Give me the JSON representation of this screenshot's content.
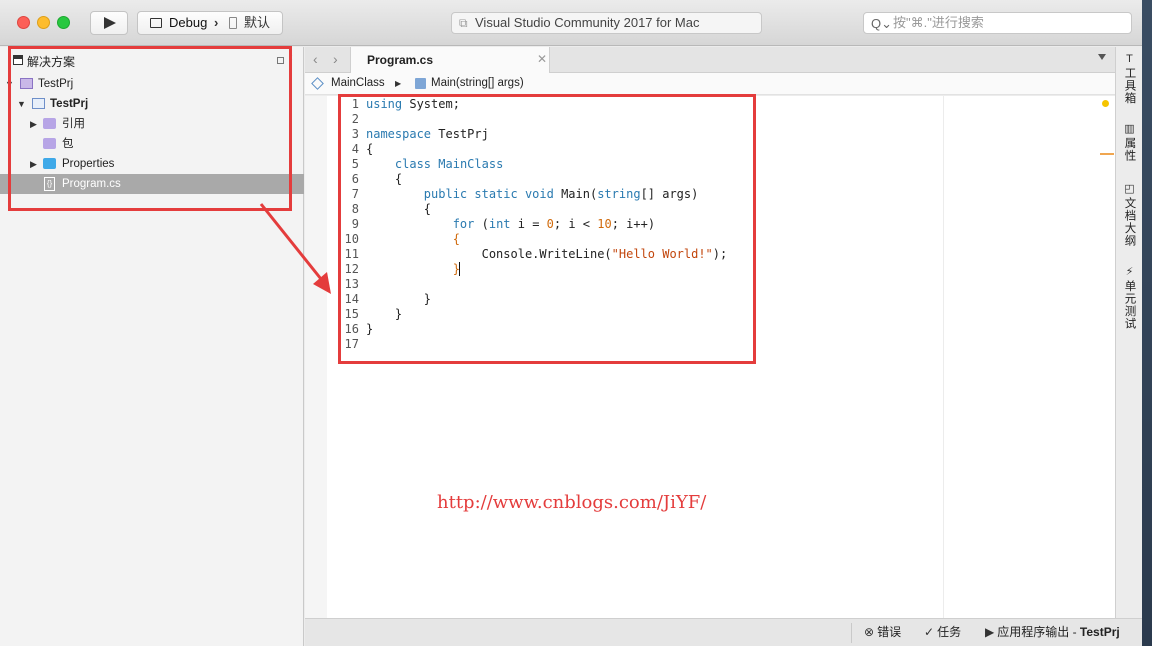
{
  "toolbar": {
    "config_label": "Debug",
    "config_chevron": "›",
    "device_label": "默认",
    "status_icon": "⧉",
    "status_title": "Visual Studio Community 2017 for Mac",
    "search_icon": "Q⌄",
    "search_placeholder": "按\"⌘.\"进行搜索"
  },
  "solution_pad": {
    "title": "解决方案",
    "close_glyph": "‹",
    "tree": [
      {
        "label": "TestPrj",
        "bold": false
      },
      {
        "label": "TestPrj",
        "bold": true
      },
      {
        "label": "引用",
        "bold": false
      },
      {
        "label": "包",
        "bold": false
      },
      {
        "label": "Properties",
        "bold": false
      },
      {
        "label": "Program.cs",
        "bold": false,
        "file_icon": "{}"
      }
    ]
  },
  "editor": {
    "nav_back": "‹",
    "nav_forward": "›",
    "tab_label": "Program.cs",
    "tab_close": "✕",
    "breadcrumb": {
      "class": "MainClass",
      "separator": "▶",
      "method": "Main(string[] args)"
    },
    "lines": [
      {
        "n": "1",
        "tokens": [
          {
            "t": "using",
            "k": "kw"
          },
          {
            "t": " System;"
          }
        ]
      },
      {
        "n": "2",
        "tokens": []
      },
      {
        "n": "3",
        "tokens": [
          {
            "t": "namespace",
            "k": "kw"
          },
          {
            "t": " TestPrj"
          }
        ]
      },
      {
        "n": "4",
        "tokens": [
          {
            "t": "{"
          }
        ]
      },
      {
        "n": "5",
        "tokens": [
          {
            "t": "    "
          },
          {
            "t": "class",
            "k": "kw"
          },
          {
            "t": " "
          },
          {
            "t": "MainClass",
            "k": "ty"
          }
        ]
      },
      {
        "n": "6",
        "tokens": [
          {
            "t": "    {"
          }
        ]
      },
      {
        "n": "7",
        "tokens": [
          {
            "t": "        "
          },
          {
            "t": "public static void",
            "k": "kw"
          },
          {
            "t": " Main("
          },
          {
            "t": "string",
            "k": "kw"
          },
          {
            "t": "[] args)"
          }
        ]
      },
      {
        "n": "8",
        "tokens": [
          {
            "t": "        {"
          }
        ]
      },
      {
        "n": "9",
        "tokens": [
          {
            "t": "            "
          },
          {
            "t": "for",
            "k": "kw"
          },
          {
            "t": " ("
          },
          {
            "t": "int",
            "k": "kw"
          },
          {
            "t": " i = "
          },
          {
            "t": "0",
            "k": "nm"
          },
          {
            "t": "; i < "
          },
          {
            "t": "10",
            "k": "nm"
          },
          {
            "t": "; i++)"
          }
        ]
      },
      {
        "n": "10",
        "tokens": [
          {
            "t": "            "
          },
          {
            "t": "{",
            "k": "nm"
          }
        ]
      },
      {
        "n": "11",
        "tokens": [
          {
            "t": "                Console.WriteLine("
          },
          {
            "t": "\"Hello World!\"",
            "k": "st"
          },
          {
            "t": ");"
          }
        ]
      },
      {
        "n": "12",
        "tokens": [
          {
            "t": "            "
          },
          {
            "t": "}",
            "k": "nm"
          },
          {
            "t": "",
            "k": "caret"
          }
        ]
      },
      {
        "n": "13",
        "tokens": []
      },
      {
        "n": "14",
        "tokens": [
          {
            "t": "        }"
          }
        ]
      },
      {
        "n": "15",
        "tokens": [
          {
            "t": "    }"
          }
        ]
      },
      {
        "n": "16",
        "tokens": [
          {
            "t": "}"
          }
        ]
      },
      {
        "n": "17",
        "tokens": []
      }
    ]
  },
  "right_bar": [
    {
      "icon": "T",
      "label": "工具箱"
    },
    {
      "icon": "▥",
      "label": "属性"
    },
    {
      "icon": "◰",
      "label": "文档大纲"
    },
    {
      "icon": "⚡",
      "label": "单元测试"
    }
  ],
  "status_bar": {
    "errors_icon": "⊗",
    "errors_label": "错误",
    "tasks_icon": "✓",
    "tasks_label": "任务",
    "output_icon": "▶",
    "output_label": "应用程序输出 - ",
    "output_project": "TestPrj"
  },
  "annotation": {
    "watermark": "http://www.cnblogs.com/JiYF/",
    "color": "#e43c3c"
  }
}
